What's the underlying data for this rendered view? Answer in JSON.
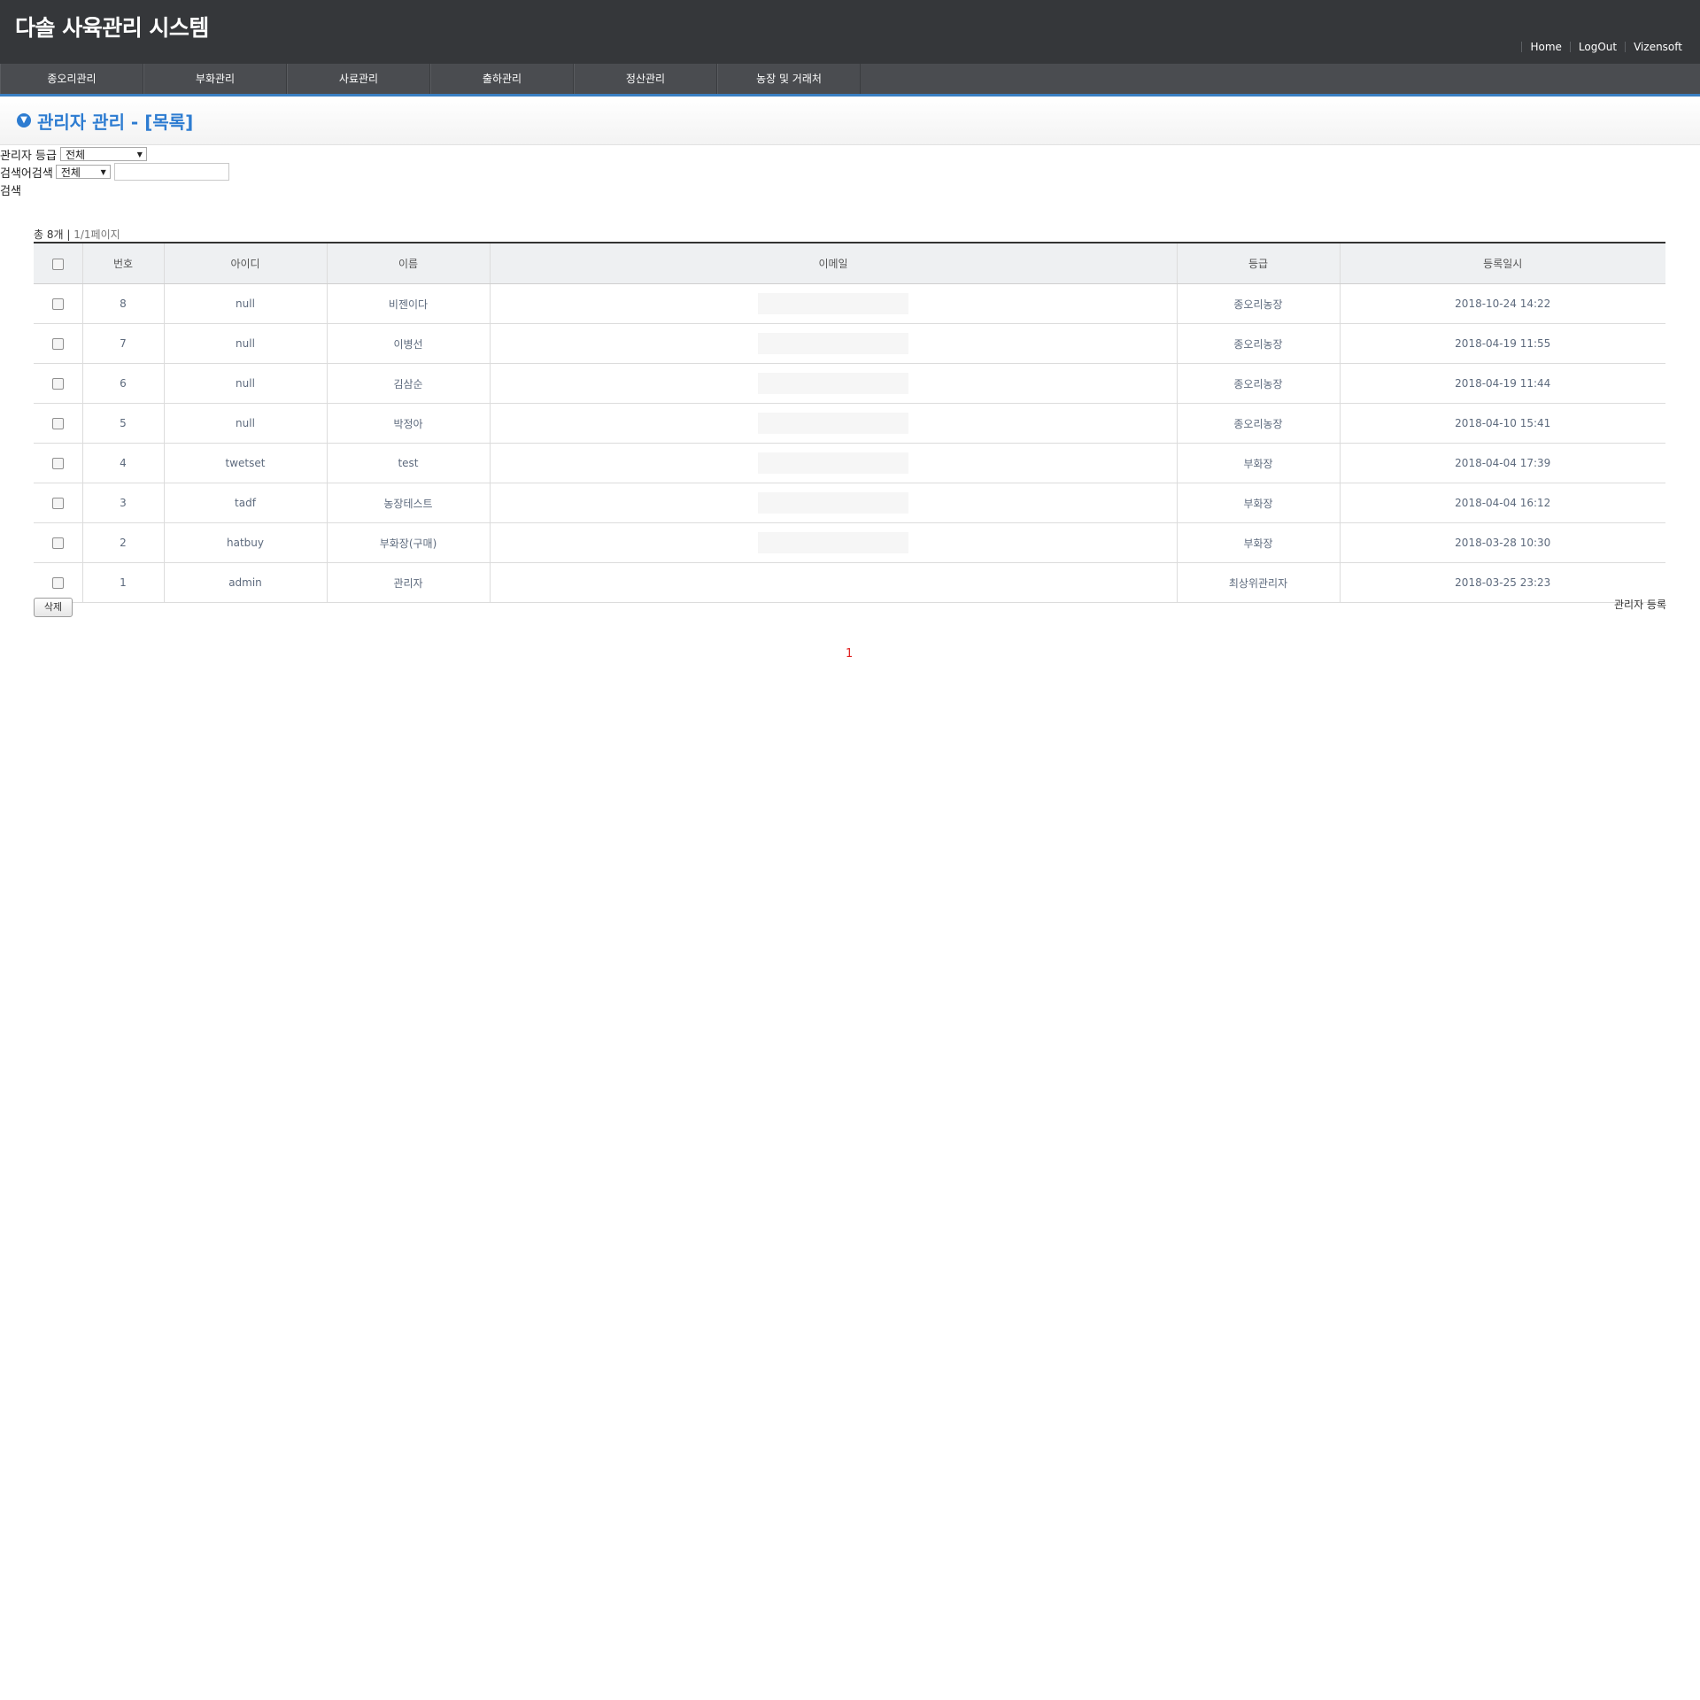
{
  "header": {
    "title": "다솔 사육관리 시스템",
    "links": [
      "Home",
      "LogOut",
      "Vizensoft"
    ]
  },
  "nav": [
    "종오리관리",
    "부화관리",
    "사료관리",
    "출하관리",
    "정산관리",
    "농장 및 거래처"
  ],
  "page": {
    "title": "관리자 관리 - [목록]"
  },
  "filters": {
    "grade_label": "관리자 등급",
    "grade_value": "전체",
    "search_label": "검색어검색",
    "search_field_value": "전체",
    "search_input_value": "",
    "search_button": "검색"
  },
  "summary": {
    "total": "총 8개",
    "separator": "|",
    "pages": "1/1페이지"
  },
  "table": {
    "columns": [
      "번호",
      "아이디",
      "이름",
      "이메일",
      "등급",
      "등록일시"
    ],
    "rows": [
      {
        "no": "8",
        "id": "null",
        "name": "비젠이다",
        "grade": "종오리농장",
        "date": "2018-10-24 14:22"
      },
      {
        "no": "7",
        "id": "null",
        "name": "이병선",
        "grade": "종오리농장",
        "date": "2018-04-19 11:55"
      },
      {
        "no": "6",
        "id": "null",
        "name": "김삼순",
        "grade": "종오리농장",
        "date": "2018-04-19 11:44"
      },
      {
        "no": "5",
        "id": "null",
        "name": "박정아",
        "grade": "종오리농장",
        "date": "2018-04-10 15:41"
      },
      {
        "no": "4",
        "id": "twetset",
        "name": "test",
        "grade": "부화장",
        "date": "2018-04-04 17:39"
      },
      {
        "no": "3",
        "id": "tadf",
        "name": "농장테스트",
        "grade": "부화장",
        "date": "2018-04-04 16:12"
      },
      {
        "no": "2",
        "id": "hatbuy",
        "name": "부화장(구매)",
        "grade": "부화장",
        "date": "2018-03-28 10:30"
      },
      {
        "no": "1",
        "id": "admin",
        "name": "관리자",
        "grade": "최상위관리자",
        "date": "2018-03-25 23:23"
      }
    ]
  },
  "actions": {
    "delete": "삭제",
    "register": "관리자 등록"
  },
  "pagination": {
    "current": "1"
  },
  "colors": {
    "header_bg": "#35373a",
    "nav_bg": "#4a4c50",
    "accent": "#2d7cd1",
    "pager_active": "#e02020"
  }
}
